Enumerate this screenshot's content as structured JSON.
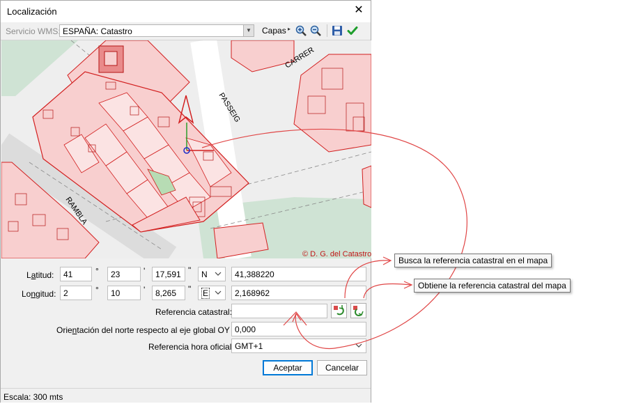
{
  "window": {
    "title": "Localización",
    "close_glyph": "✕"
  },
  "toolbar": {
    "wms_label": "Servicio WMS:",
    "wms_value": "ESPAÑA: Catastro",
    "capas_label": "Capas",
    "icons": [
      "zoom-in-icon",
      "zoom-out-icon",
      "save-icon",
      "checkmark-icon"
    ]
  },
  "map": {
    "street_labels": [
      "CARRER",
      "PASSEIG",
      "RAMBLA"
    ],
    "copyright": "© D. G. del Catastro"
  },
  "form": {
    "latitud": {
      "label_pre": "L",
      "label_u": "a",
      "label_post": "titud:",
      "deg": "41",
      "min": "23",
      "sec": "17,591",
      "hemisphere": "N",
      "decimal": "41,388220"
    },
    "longitud": {
      "label_pre": "Lo",
      "label_u": "n",
      "label_post": "gitud:",
      "deg": "2",
      "min": "10",
      "sec": "8,265",
      "hemisphere": "E",
      "decimal": "2,168962"
    },
    "deg_symbol": "°",
    "min_symbol": "'",
    "sec_symbol": "\"",
    "ref_catastral_label": "Referencia catastral:",
    "ref_catastral_value": "",
    "orientacion_label_pre": "Orie",
    "orientacion_label_u": "n",
    "orientacion_label_post": "tación del norte respecto al eje global OY (º):",
    "orientacion_value": "0,000",
    "hora_label": "Referencia hora oficial:",
    "hora_value": "GMT+1"
  },
  "buttons": {
    "aceptar": "Aceptar",
    "cancelar": "Cancelar"
  },
  "status": {
    "text": "Escala: 300 mts"
  },
  "tooltips": {
    "busca": "Busca la referencia catastral en el mapa",
    "obtiene": "Obtiene la referencia catastral del mapa"
  },
  "colors": {
    "parcel_fill": "#f8cfcf",
    "parcel_stroke": "#d21f1f",
    "green": "#cfe6d4",
    "accent": "#0078d7",
    "callout": "#e04646"
  }
}
